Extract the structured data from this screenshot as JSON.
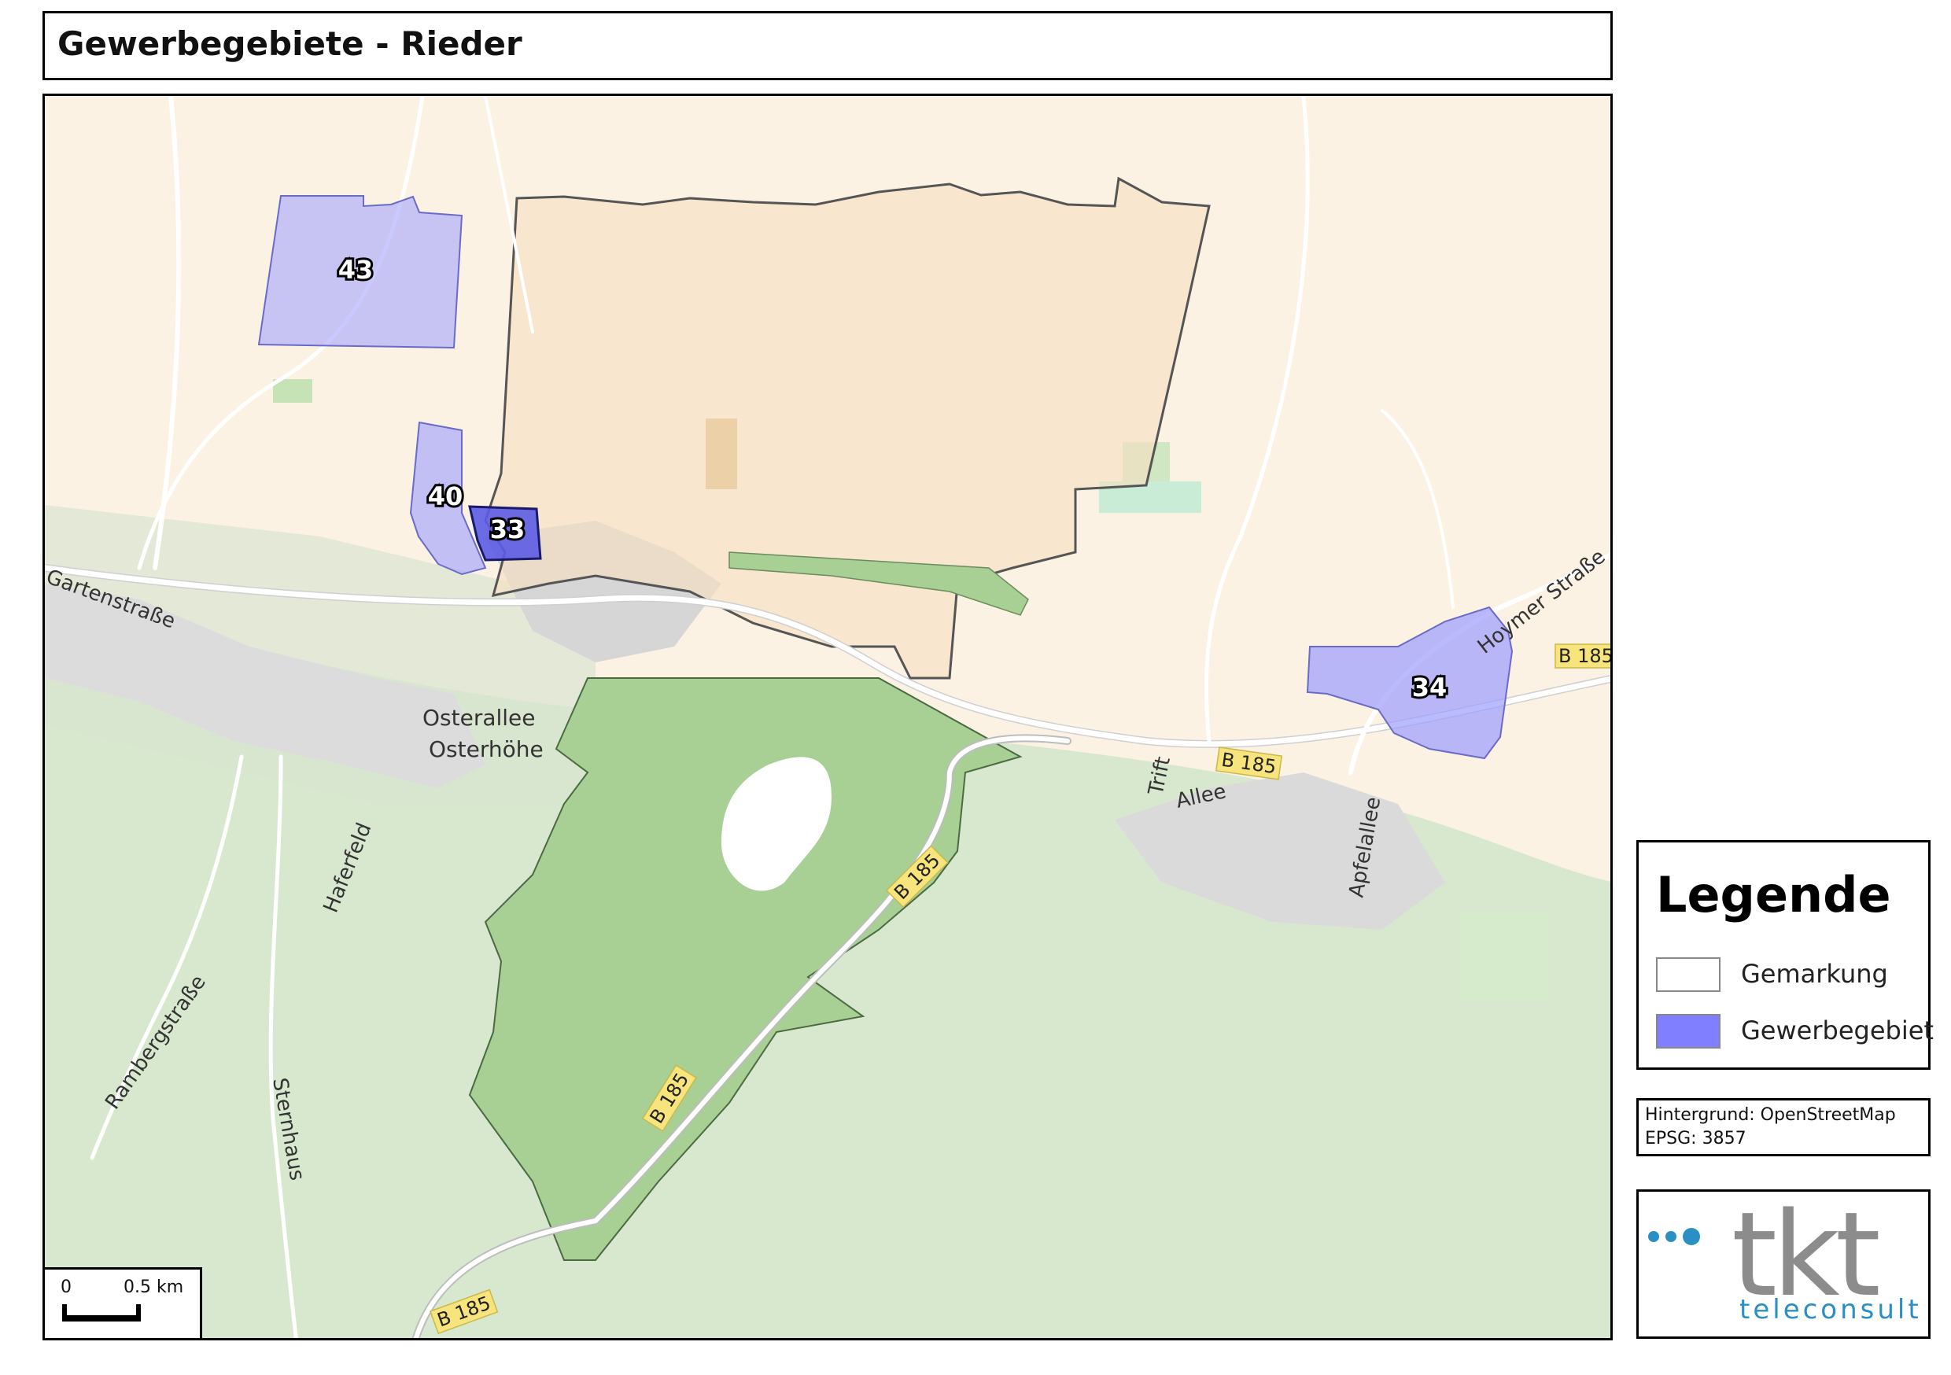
{
  "title": "Gewerbegebiete - Rieder",
  "areas": [
    {
      "id": "43",
      "color": "#9c9cff"
    },
    {
      "id": "40",
      "color": "#9c9cff"
    },
    {
      "id": "33",
      "color": "#5c5ce6"
    },
    {
      "id": "34",
      "color": "#9c9cff"
    }
  ],
  "places": {
    "gartenstrasse": "Gartenstraße",
    "osterallee": "Osterallee",
    "osterhoehe": "Osterhöhe",
    "haferfeld": "Haferfeld",
    "rambergstrasse": "Rambergstraße",
    "sternhaus": "Sternhaus",
    "trift": "Trift",
    "allee": "Allee",
    "apfelallee": "Apfelallee",
    "hoymer_strasse": "Hoymer Straße"
  },
  "road_shields": {
    "b185_a": "B 185",
    "b185_b": "B 185",
    "b185_c": "B 185",
    "b185_d": "B 185",
    "b185_e": "B 185"
  },
  "scalebar": {
    "start": "0",
    "end": "0.5 km"
  },
  "legend": {
    "title": "Legende",
    "items": [
      {
        "label": "Gemarkung",
        "color": "#ffffff"
      },
      {
        "label": "Gewerbegebiet",
        "color": "#7f7fff"
      }
    ]
  },
  "source": {
    "background": "Hintergrund: OpenStreetMap",
    "epsg": "EPSG: 3857"
  },
  "logo": {
    "main": "tkt",
    "sub": "teleconsult"
  }
}
